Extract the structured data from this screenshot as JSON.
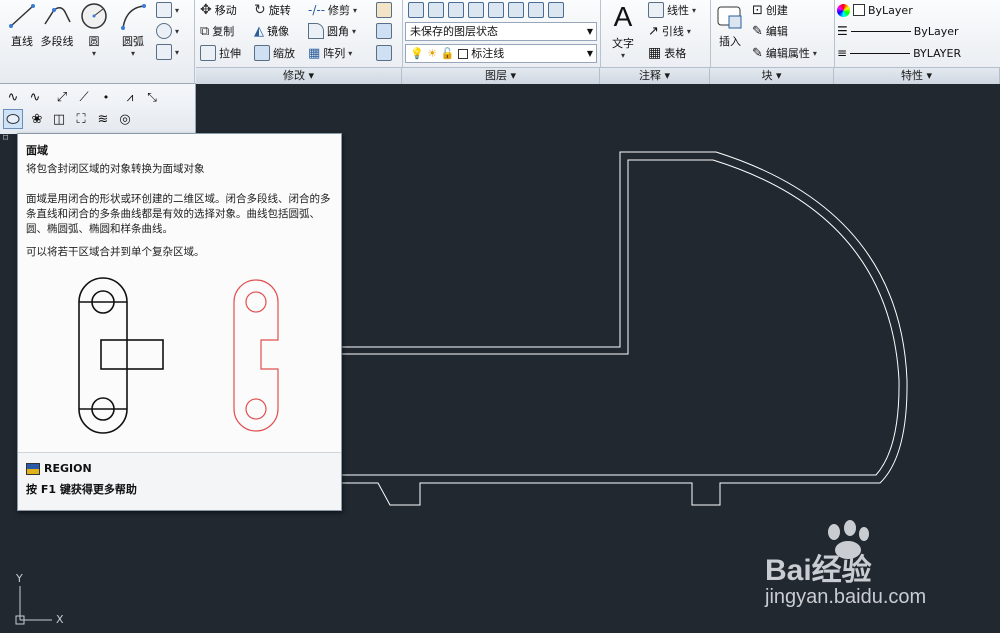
{
  "draw": {
    "line": "直线",
    "polyline": "多段线",
    "circle": "圆",
    "arc": "圆弧"
  },
  "modify": {
    "panel": "修改",
    "move": "移动",
    "rotate": "旋转",
    "trim": "修剪",
    "copy": "复制",
    "mirror": "镜像",
    "fillet": "圆角",
    "stretch": "拉伸",
    "scale": "缩放",
    "array": "阵列"
  },
  "layers": {
    "panel": "图层",
    "state": "未保存的图层状态",
    "current": "标注线"
  },
  "annotation": {
    "panel": "注释",
    "text": "文字",
    "linear": "线性",
    "leader": "引线",
    "table": "表格"
  },
  "block": {
    "panel": "块",
    "insert": "插入",
    "create": "创建",
    "edit": "编辑",
    "edit_attr": "编辑属性"
  },
  "properties": {
    "panel": "特性",
    "color": "ByLayer",
    "linetype": "ByLayer",
    "lineweight": "BYLAYER"
  },
  "tooltip": {
    "title": "面域",
    "desc": "将包含封闭区域的对象转换为面域对象",
    "p1": "面域是用闭合的形状或环创建的二维区域。闭合多段线、闭合的多条直线和闭合的多条曲线都是有效的选择对象。曲线包括圆弧、圆、椭圆弧、椭圆和样条曲线。",
    "p2": "可以将若干区域合并到单个复杂区域。",
    "command": "REGION",
    "help": "按 F1 键获得更多帮助"
  },
  "ucs": {
    "y": "Y",
    "x": "X"
  },
  "watermark": {
    "brand": "Bai经验",
    "url": "jingyan.baidu.com"
  },
  "colors": {
    "canvas": "#212830",
    "drawing": "#ffffff",
    "region": "#e05050"
  }
}
